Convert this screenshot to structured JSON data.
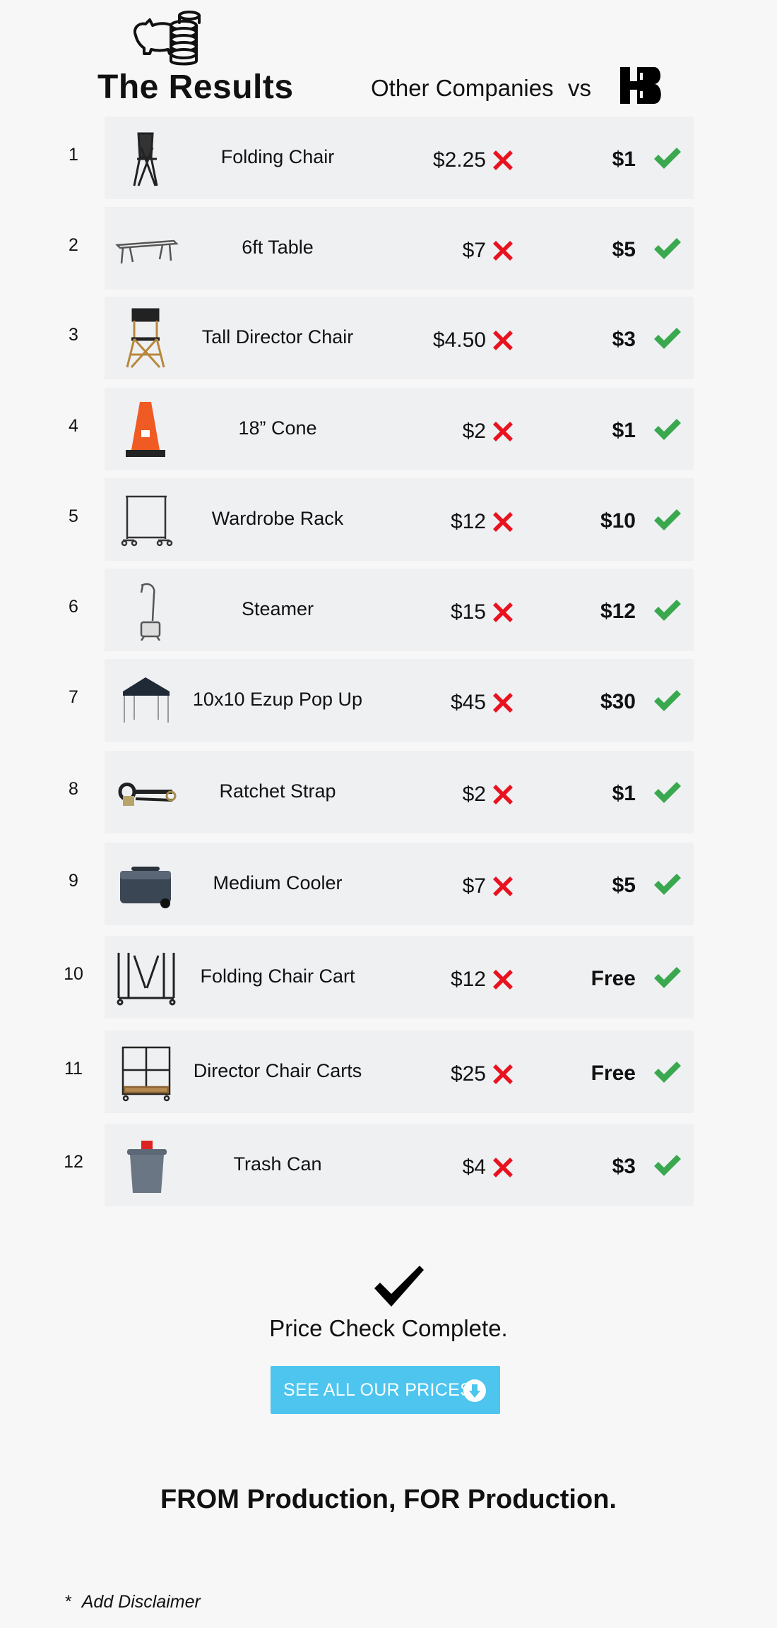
{
  "header": {
    "title": "The Results",
    "competitor_label": "Other Companies",
    "vs_label": "vs"
  },
  "colors": {
    "background": "#f7f7f7",
    "row_card": "#eff0f2",
    "x_mark": "#e8131f",
    "check_mark": "#3aa84f",
    "cta_background": "#4dc5ee"
  },
  "rows": [
    {
      "num": "1",
      "name": "Folding Chair",
      "other_price": "$2.25",
      "our_price": "$1",
      "thumb": "folding-chair-icon"
    },
    {
      "num": "2",
      "name": "6ft Table",
      "other_price": "$7",
      "our_price": "$5",
      "thumb": "table-icon"
    },
    {
      "num": "3",
      "name": "Tall Director Chair",
      "other_price": "$4.50",
      "our_price": "$3",
      "thumb": "director-chair-icon"
    },
    {
      "num": "4",
      "name": "18” Cone",
      "other_price": "$2",
      "our_price": "$1",
      "thumb": "cone-icon"
    },
    {
      "num": "5",
      "name": "Wardrobe Rack",
      "other_price": "$12",
      "our_price": "$10",
      "thumb": "wardrobe-rack-icon"
    },
    {
      "num": "6",
      "name": "Steamer",
      "other_price": "$15",
      "our_price": "$12",
      "thumb": "steamer-icon"
    },
    {
      "num": "7",
      "name": "10x10 Ezup Pop Up",
      "other_price": "$45",
      "our_price": "$30",
      "thumb": "canopy-tent-icon"
    },
    {
      "num": "8",
      "name": "Ratchet Strap",
      "other_price": "$2",
      "our_price": "$1",
      "thumb": "ratchet-strap-icon"
    },
    {
      "num": "9",
      "name": "Medium Cooler",
      "other_price": "$7",
      "our_price": "$5",
      "thumb": "cooler-icon"
    },
    {
      "num": "10",
      "name": "Folding Chair Cart",
      "other_price": "$12",
      "our_price": "Free",
      "thumb": "chair-cart-icon"
    },
    {
      "num": "11",
      "name": "Director Chair Carts",
      "other_price": "$25",
      "our_price": "Free",
      "thumb": "director-cart-icon"
    },
    {
      "num": "12",
      "name": "Trash Can",
      "other_price": "$4",
      "our_price": "$3",
      "thumb": "trash-can-icon"
    }
  ],
  "footer": {
    "complete_text": "Price Check Complete.",
    "cta_label": "SEE ALL OUR PRICES",
    "tagline": "FROM Production, FOR Production.",
    "disclaimer_mark": "*",
    "disclaimer": "Add Disclaimer"
  }
}
